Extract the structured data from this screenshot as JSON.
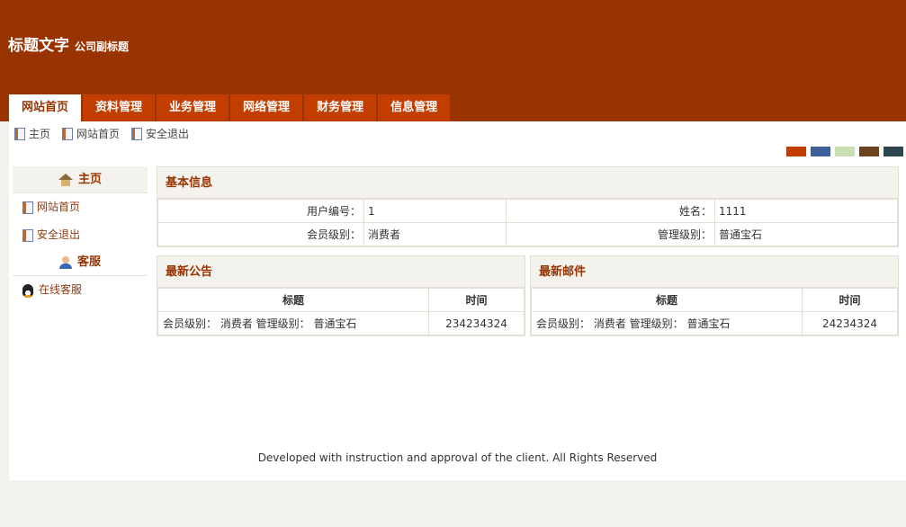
{
  "brand": {
    "title": "标题文字",
    "subtitle": "公司副标题"
  },
  "tabs": [
    {
      "label": "网站首页"
    },
    {
      "label": "资料管理"
    },
    {
      "label": "业务管理"
    },
    {
      "label": "网络管理"
    },
    {
      "label": "财务管理"
    },
    {
      "label": "信息管理"
    }
  ],
  "quick_links": [
    {
      "label": "主页"
    },
    {
      "label": "网站首页"
    },
    {
      "label": "安全退出"
    }
  ],
  "swatches": [
    "#c13d00",
    "#3e5f9a",
    "#c9dfb3",
    "#6e4420",
    "#2f474f"
  ],
  "sidebar": {
    "home_title": "主页",
    "items": [
      {
        "label": "网站首页"
      },
      {
        "label": "安全退出"
      }
    ],
    "service_title": "客服",
    "service_items": [
      {
        "label": "在线客服"
      }
    ]
  },
  "basic_info": {
    "title": "基本信息",
    "rows": [
      {
        "label1": "用户编号：",
        "value1": "1",
        "label2": "姓名：",
        "value2": "1111"
      },
      {
        "label1": "会员级别：",
        "value1": "消费者",
        "label2": "管理级别：",
        "value2": "普通宝石"
      }
    ]
  },
  "notices": {
    "title": "最新公告",
    "col_title": "标题",
    "col_time": "时间",
    "rows": [
      {
        "title": "会员级别： 消费者 管理级别： 普通宝石",
        "time": "234234324"
      }
    ]
  },
  "mails": {
    "title": "最新邮件",
    "col_title": "标题",
    "col_time": "时间",
    "rows": [
      {
        "title": "会员级别： 消费者 管理级别： 普通宝石",
        "time": "24234324"
      }
    ]
  },
  "footer": "Developed with instruction and approval of the client. All Rights Reserved"
}
